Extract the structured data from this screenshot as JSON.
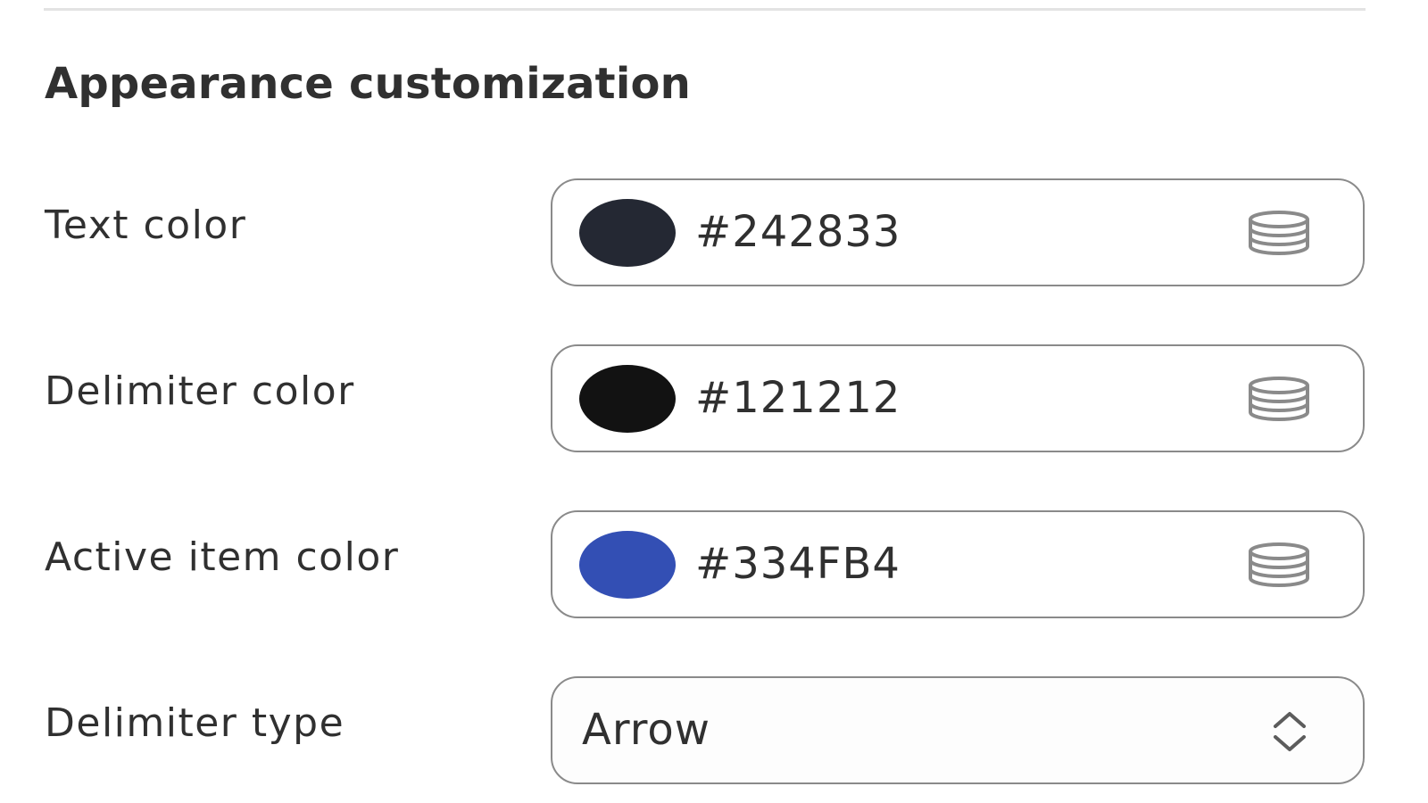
{
  "section": {
    "title": "Appearance customization"
  },
  "rows": [
    {
      "label": "Text color",
      "value": "#242833",
      "swatch_color": "#242833",
      "icon": "database-icon"
    },
    {
      "label": "Delimiter color",
      "value": "#121212",
      "swatch_color": "#121212",
      "icon": "database-icon"
    },
    {
      "label": "Active item color",
      "value": "#334FB4",
      "swatch_color": "#334FB4",
      "icon": "database-icon"
    }
  ],
  "delimiter_type": {
    "label": "Delimiter type",
    "selected": "Arrow",
    "icon": "select-chevron-icon"
  }
}
